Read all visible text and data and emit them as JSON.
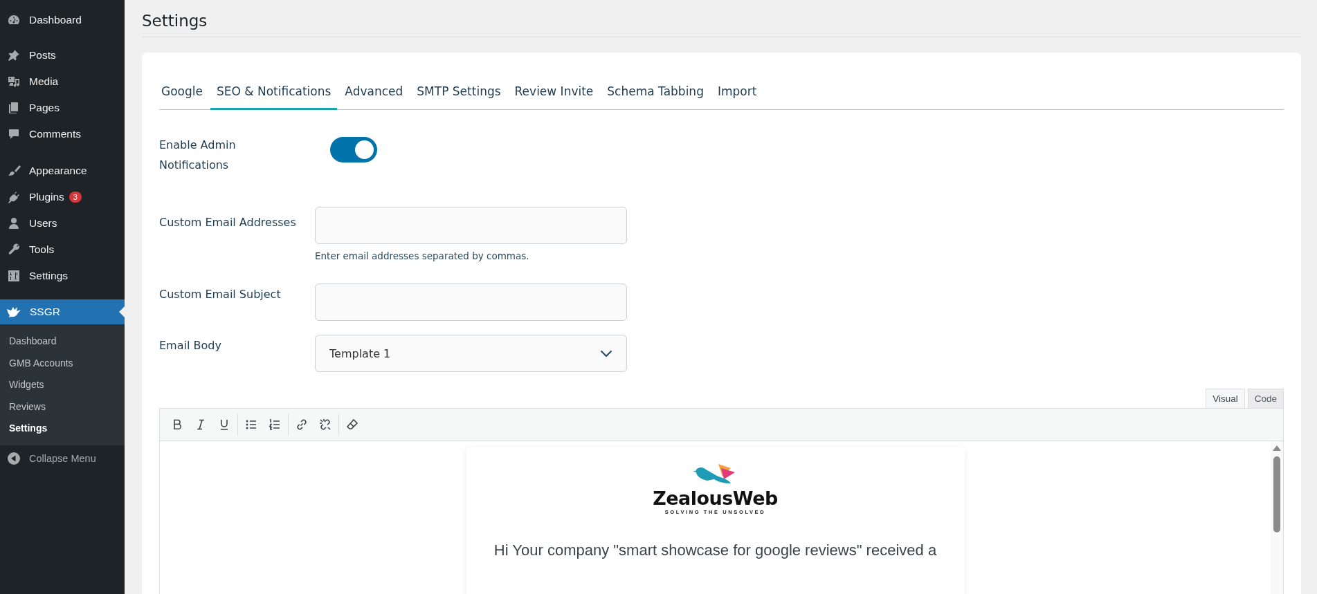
{
  "sidebar": {
    "groups": [
      {
        "items": [
          {
            "label": "Dashboard",
            "selected": false
          }
        ]
      },
      {
        "items": [
          {
            "label": "Posts",
            "selected": false
          },
          {
            "label": "Media",
            "selected": false
          },
          {
            "label": "Pages",
            "selected": false
          },
          {
            "label": "Comments",
            "selected": false
          }
        ]
      },
      {
        "items": [
          {
            "label": "Appearance",
            "selected": false
          },
          {
            "label": "Plugins",
            "selected": false,
            "badge": "3"
          },
          {
            "label": "Users",
            "selected": false
          },
          {
            "label": "Tools",
            "selected": false
          },
          {
            "label": "Settings",
            "selected": false
          }
        ]
      }
    ],
    "current": {
      "label": "SSGR",
      "selected": true,
      "submenu": [
        {
          "label": "Dashboard",
          "selected": false
        },
        {
          "label": "GMB Accounts",
          "selected": false
        },
        {
          "label": "Widgets",
          "selected": false
        },
        {
          "label": "Reviews",
          "selected": false
        },
        {
          "label": "Settings",
          "selected": true
        }
      ]
    },
    "collapse": "Collapse Menu"
  },
  "page": {
    "title": "Settings"
  },
  "tabs": [
    {
      "label": "Google",
      "selected": false
    },
    {
      "label": "SEO & Notifications",
      "selected": true
    },
    {
      "label": "Advanced",
      "selected": false
    },
    {
      "label": "SMTP Settings",
      "selected": false
    },
    {
      "label": "Review Invite",
      "selected": false
    },
    {
      "label": "Schema Tabbing",
      "selected": false
    },
    {
      "label": "Import",
      "selected": false
    }
  ],
  "form": {
    "admin_notifications": {
      "label": "Enable Admin Notifications",
      "on": true
    },
    "email_addresses": {
      "label": "Custom Email Addresses",
      "help": "Enter email addresses separated by commas."
    },
    "email_subject": {
      "label": "Custom Email Subject"
    },
    "email_body": {
      "label": "Email Body",
      "value": "Template 1"
    }
  },
  "editor": {
    "tabs": [
      {
        "label": "Visual",
        "selected": true
      },
      {
        "label": "Code",
        "selected": false
      }
    ],
    "email": {
      "logo_name": "ZealousWeb",
      "logo_tagline": "SOLVING THE UNSOLVED",
      "text": "Hi Your company \"smart showcase for google reviews\" received a"
    }
  }
}
